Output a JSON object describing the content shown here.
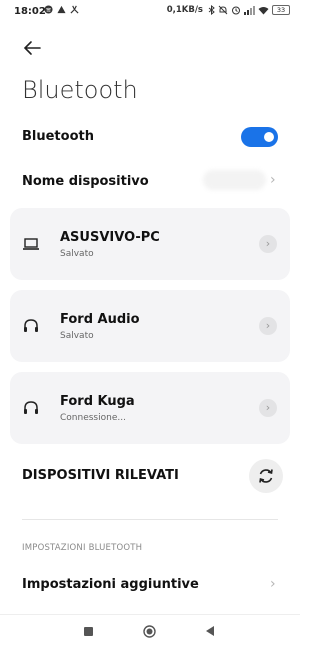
{
  "status_bar": {
    "time": "18:02",
    "speed": "0,1KB/s",
    "battery": "33",
    "left_icons": [
      "spotify-icon",
      "alert-icon",
      "tool-icon"
    ],
    "right_icons": [
      "bluetooth-icon",
      "mute-icon",
      "alarm-icon",
      "signal-icon",
      "wifi-icon"
    ]
  },
  "page": {
    "title": "Bluetooth"
  },
  "bluetooth_toggle": {
    "label": "Bluetooth",
    "enabled": true,
    "accent": "#1a73e8"
  },
  "device_name": {
    "label": "Nome dispositivo"
  },
  "devices": [
    {
      "name": "ASUSVIVO-PC",
      "status": "Salvato",
      "icon": "laptop-icon"
    },
    {
      "name": "Ford Audio",
      "status": "Salvato",
      "icon": "headphones-icon"
    },
    {
      "name": "Ford Kuga",
      "status": "Connessione...",
      "icon": "headphones-icon"
    }
  ],
  "detected": {
    "label": "DISPOSITIVI RILEVATI",
    "icon": "refresh-icon"
  },
  "settings_section": {
    "header": "IMPOSTAZIONI BLUETOOTH"
  },
  "additional_settings": {
    "label": "Impostazioni aggiuntive"
  }
}
